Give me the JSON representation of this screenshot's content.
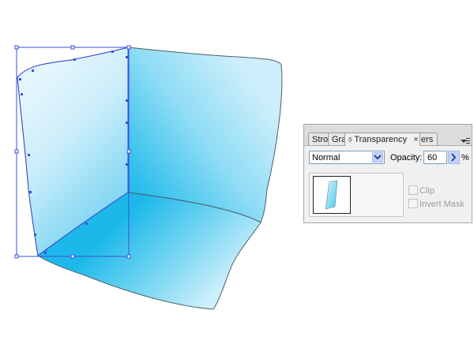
{
  "panel": {
    "tabs": [
      {
        "label": "Stroke",
        "visible_text": "Stro"
      },
      {
        "label": "Gradient",
        "visible_text": "Gra"
      },
      {
        "label": "Transparency",
        "visible_text": "Transparency"
      },
      {
        "label": "Layers",
        "visible_text": "ers"
      }
    ],
    "tab_close_glyph": "×",
    "tab_prefix_glyph": "◊",
    "blend_mode": "Normal",
    "opacity_label": "Opacity:",
    "opacity_value": "60",
    "opacity_unit": "%",
    "clip_label": "Clip",
    "invert_mask_label": "Invert Mask",
    "colors": {
      "panel_bg": "#f0f0f0",
      "dropdown_accent": "#c3d3fd",
      "disabled_text": "#9b9b9b"
    }
  },
  "artwork": {
    "shape": "3D cube corner (three faces)",
    "fill_light": "#dbf1fb",
    "fill_mid": "#5fcdf0",
    "fill_dark": "#1cb8ea",
    "selection_color": "#3b4fd8"
  }
}
